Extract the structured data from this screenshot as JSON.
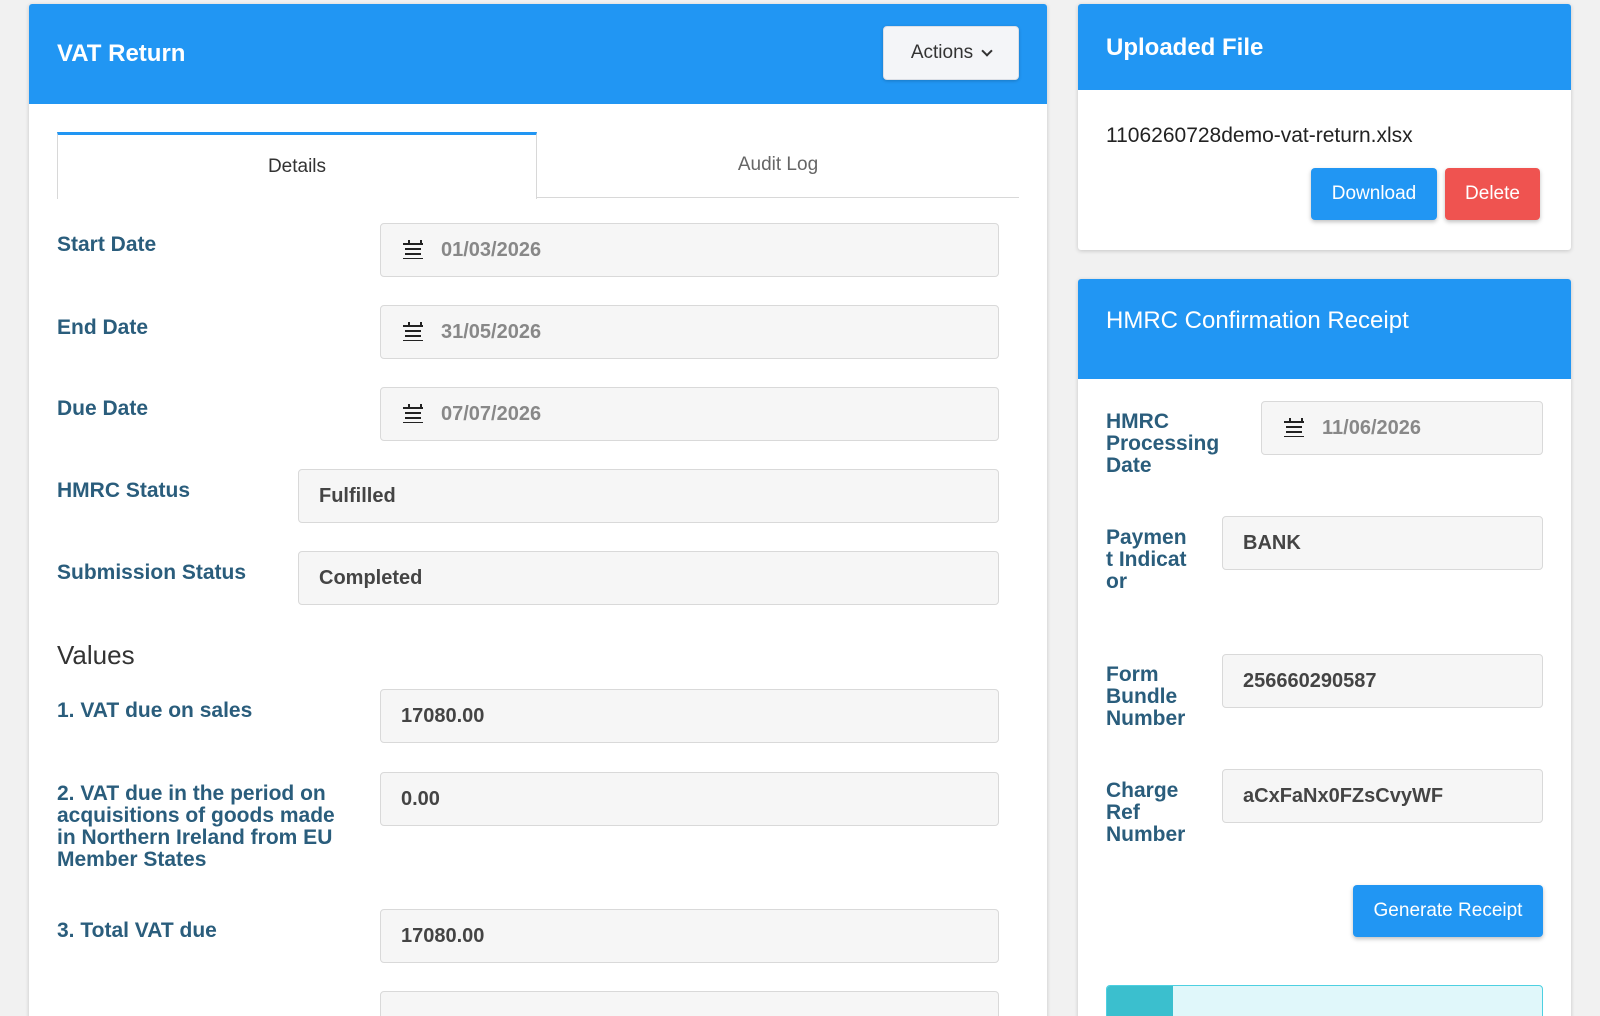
{
  "vat_return": {
    "title": "VAT Return",
    "actions_label": "Actions",
    "tabs": [
      {
        "label": "Details",
        "active": true
      },
      {
        "label": "Audit Log",
        "active": false
      }
    ],
    "fields": {
      "start_date": {
        "label": "Start Date",
        "value": "01/03/2026"
      },
      "end_date": {
        "label": "End Date",
        "value": "31/05/2026"
      },
      "due_date": {
        "label": "Due Date",
        "value": "07/07/2026"
      },
      "hmrc_status": {
        "label": "HMRC Status",
        "value": "Fulfilled"
      },
      "submission_status": {
        "label": "Submission Status",
        "value": "Completed"
      }
    },
    "values_title": "Values",
    "values": [
      {
        "label": "1. VAT due on sales",
        "value": "17080.00"
      },
      {
        "label": "2. VAT due in the period on acquisitions of goods made in Northern Ireland from EU Member States",
        "value": "0.00"
      },
      {
        "label": "3. Total VAT due",
        "value": "17080.00"
      }
    ]
  },
  "uploaded_file": {
    "title": "Uploaded File",
    "file_name": "1106260728demo-vat-return.xlsx",
    "download_label": "Download",
    "delete_label": "Delete"
  },
  "hmrc_receipt": {
    "title": "HMRC Confirmation Receipt",
    "processing_date": {
      "label": "HMRC Processing Date",
      "value": "11/06/2026"
    },
    "payment_indicator": {
      "label": "Payment Indicator",
      "value": "BANK"
    },
    "form_bundle_number": {
      "label": "Form Bundle Number",
      "value": "256660290587"
    },
    "charge_ref_number": {
      "label": "Charge Ref Number",
      "value": "aCxFaNx0FZsCvyWF"
    },
    "generate_label": "Generate Receipt"
  },
  "colors": {
    "primary": "#2196f3",
    "danger": "#ef5350",
    "label": "#2a5d7c",
    "info": "#e0f7fa"
  }
}
